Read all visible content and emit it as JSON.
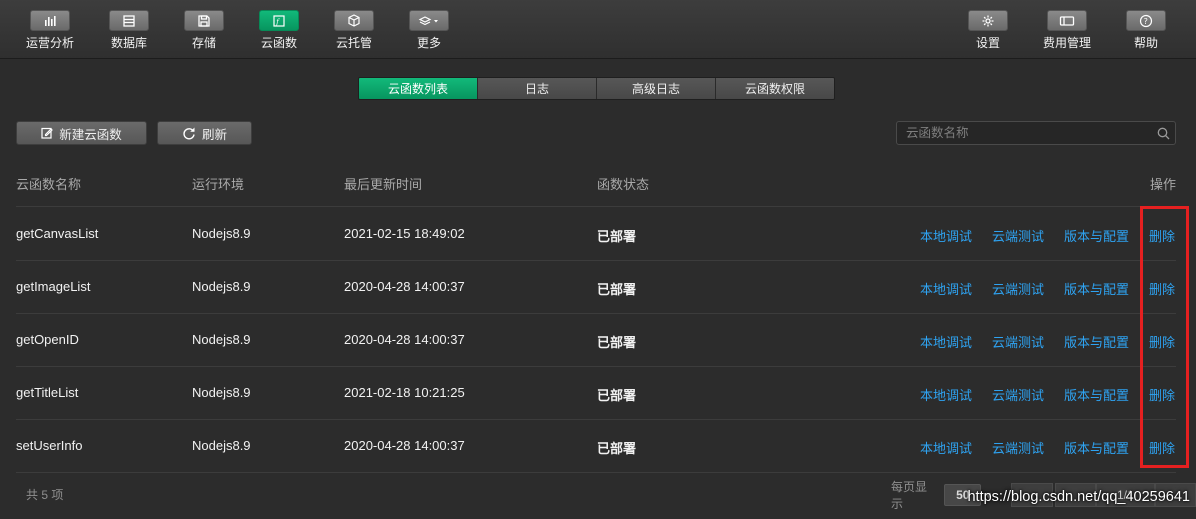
{
  "toolbar": {
    "left": [
      {
        "label": "运营分析",
        "icon": "bar-chart-icon"
      },
      {
        "label": "数据库",
        "icon": "database-icon"
      },
      {
        "label": "存储",
        "icon": "save-icon"
      },
      {
        "label": "云函数",
        "icon": "cloud-function-icon",
        "active": true
      },
      {
        "label": "云托管",
        "icon": "cube-icon"
      },
      {
        "label": "更多",
        "icon": "layers-icon"
      }
    ],
    "right": [
      {
        "label": "设置",
        "icon": "gear-icon"
      },
      {
        "label": "费用管理",
        "icon": "billing-card-icon"
      },
      {
        "label": "帮助",
        "icon": "help-icon"
      }
    ]
  },
  "tabs": [
    "云函数列表",
    "日志",
    "高级日志",
    "云函数权限"
  ],
  "actions": {
    "new_label": "新建云函数",
    "refresh_label": "刷新"
  },
  "search": {
    "placeholder": "云函数名称",
    "value": ""
  },
  "table": {
    "headers": {
      "name": "云函数名称",
      "runtime": "运行环境",
      "updated": "最后更新时间",
      "status": "函数状态",
      "ops": "操作"
    },
    "rows": [
      {
        "name": "getCanvasList",
        "runtime": "Nodejs8.9",
        "updated": "2021-02-15 18:49:02",
        "status": "已部署"
      },
      {
        "name": "getImageList",
        "runtime": "Nodejs8.9",
        "updated": "2020-04-28 14:00:37",
        "status": "已部署"
      },
      {
        "name": "getOpenID",
        "runtime": "Nodejs8.9",
        "updated": "2020-04-28 14:00:37",
        "status": "已部署"
      },
      {
        "name": "getTitleList",
        "runtime": "Nodejs8.9",
        "updated": "2021-02-18 10:21:25",
        "status": "已部署"
      },
      {
        "name": "setUserInfo",
        "runtime": "Nodejs8.9",
        "updated": "2020-04-28 14:00:37",
        "status": "已部署"
      }
    ],
    "row_actions": {
      "local_debug": "本地调试",
      "cloud_test": "云端测试",
      "version_config": "版本与配置",
      "delete": "删除"
    }
  },
  "footer": {
    "total": "共 5 项",
    "page_size_label": "每页显示",
    "page_size": "50",
    "page_info": "1/1"
  },
  "watermark": "https://blog.csdn.net/qq_40259641",
  "colors": {
    "accent": "#07c160",
    "link": "#2ea3f2",
    "highlight": "#e52020",
    "background": "#2c2c2c"
  }
}
